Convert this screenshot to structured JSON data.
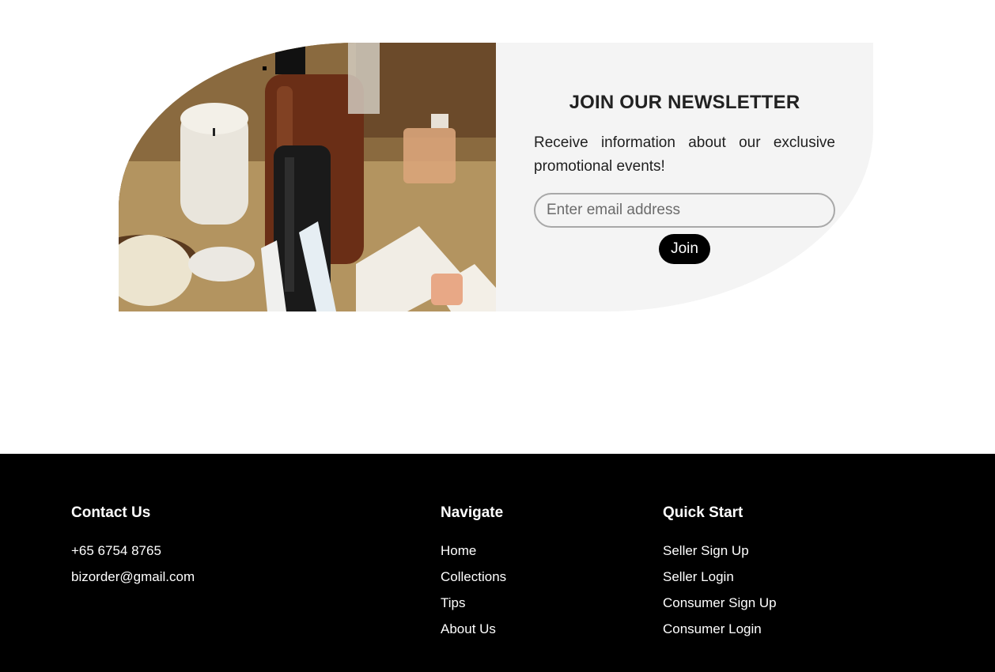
{
  "newsletter": {
    "heading": "JOIN OUR NEWSLETTER",
    "description": "Receive information about our exclusive promotional events!",
    "email_placeholder": "Enter email address",
    "join_label": "Join",
    "image": "cosmetics-products-photo"
  },
  "footer": {
    "contact": {
      "heading": "Contact Us",
      "phone": "+65 6754 8765",
      "email": "bizorder@gmail.com"
    },
    "navigate": {
      "heading": "Navigate",
      "items": [
        "Home",
        "Collections",
        "Tips",
        "About Us"
      ]
    },
    "quick_start": {
      "heading": "Quick Start",
      "items": [
        "Seller Sign Up",
        "Seller Login",
        "Consumer Sign Up",
        "Consumer Login"
      ]
    }
  },
  "colors": {
    "panel_background": "#f4f4f4",
    "footer_background": "#000000",
    "button_background": "#000000",
    "footer_text": "#ffffff"
  }
}
